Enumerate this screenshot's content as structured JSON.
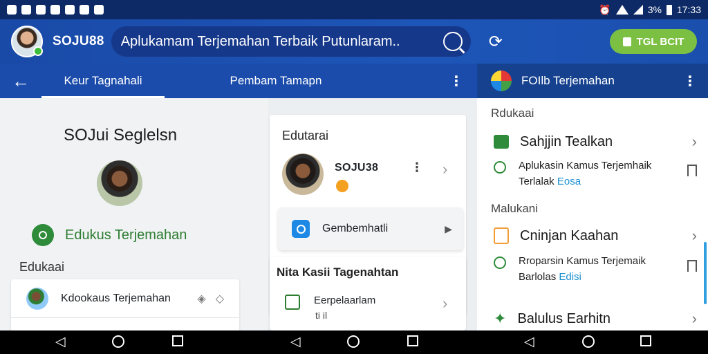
{
  "status_bar": {
    "battery_text": "3%",
    "time": "17:33",
    "left_icons": [
      "notification-icon",
      "notification-icon",
      "notification-icon",
      "notification-icon",
      "notification-icon",
      "notification-icon",
      "notification-icon"
    ]
  },
  "app_bar": {
    "brand": "SOJU88",
    "search_text": "Aplukamam Terjemahan Terbaik Putunlaram..",
    "cta_label": "TGL BCIT",
    "accent_color": "#7cc043",
    "bar_color": "#1b4cab"
  },
  "tabs": {
    "items": [
      {
        "label": "Keur Tagnahali",
        "active": true
      },
      {
        "label": "Pembam Tamapn",
        "active": false
      }
    ]
  },
  "right_header": {
    "title": "FOIlb Terjemahan"
  },
  "left_panel": {
    "title": "SOJui Seglelsn",
    "feature_label": "Edukus Terjemahan",
    "section_label": "Edukaai",
    "list_items": [
      {
        "label": "Kdookaus Terjemahan"
      }
    ]
  },
  "middle_panel": {
    "card_title": "Edutarai",
    "user_name": "SOJU38",
    "subcard_label": "Gembemhatli",
    "card2_title": "Nita Kasii Tagenahtan",
    "card2_item": "Eerpelaarlam",
    "card2_sub": "ti   il"
  },
  "right_panel": {
    "section1": "Rdukaai",
    "row1_title": "Sahjjin Tealkan",
    "row1_sub_line1": "Aplukasin Kamus Terjemhaik",
    "row1_sub_line2": "Terlalak",
    "row1_sub_link": "Eosa",
    "section2": "Malukani",
    "row2_title": "Cninjan Kaahan",
    "row2_sub_line1": "Rroparsin Kamus Terjemaik",
    "row2_sub_line2": "Barlolas",
    "row2_sub_link": "Edisi",
    "row3_title": "Balulus Earhitn"
  }
}
